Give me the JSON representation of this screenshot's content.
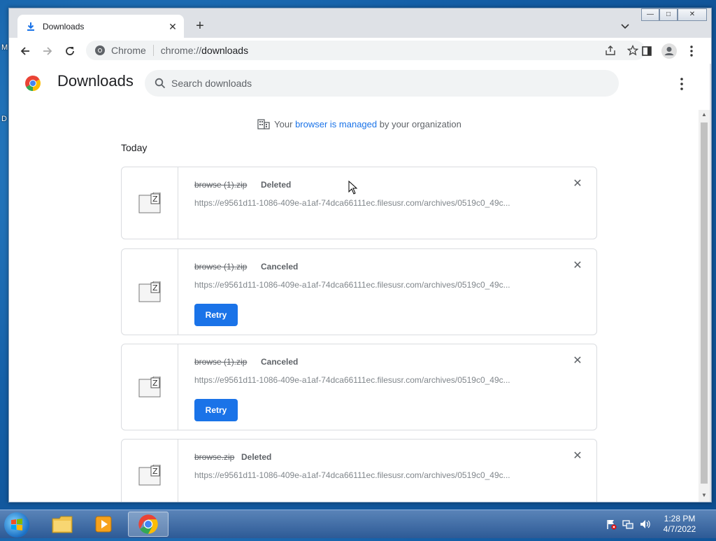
{
  "desktop": {
    "icon_labels": [
      "M",
      "D"
    ]
  },
  "window": {
    "controls": {
      "minimize": "—",
      "maximize": "□",
      "close": "✕"
    }
  },
  "tab": {
    "title": "Downloads",
    "icon": "download-icon",
    "close_label": "✕"
  },
  "new_tab_label": "+",
  "omnibox": {
    "site_label": "Chrome",
    "scheme": "chrome://",
    "host": "downloads"
  },
  "page": {
    "title": "Downloads",
    "search": {
      "placeholder": "Search downloads",
      "value": ""
    },
    "managed": {
      "prefix": "Your ",
      "link": "browser is managed",
      "suffix": " by your organization"
    },
    "section": "Today",
    "items": [
      {
        "file": "browse (1).zip",
        "status": "Deleted",
        "url": "https://e9561d11-1086-409e-a1af-74dca66111ec.filesusr.com/archives/0519c0_49c...",
        "retry": null
      },
      {
        "file": "browse (1).zip",
        "status": "Canceled",
        "url": "https://e9561d11-1086-409e-a1af-74dca66111ec.filesusr.com/archives/0519c0_49c...",
        "retry": "Retry"
      },
      {
        "file": "browse (1).zip",
        "status": "Canceled",
        "url": "https://e9561d11-1086-409e-a1af-74dca66111ec.filesusr.com/archives/0519c0_49c...",
        "retry": "Retry"
      },
      {
        "file": "browse.zip",
        "status": "Deleted",
        "url": "https://e9561d11-1086-409e-a1af-74dca66111ec.filesusr.com/archives/0519c0_49c...",
        "retry": null
      }
    ],
    "remove_label": "✕"
  },
  "taskbar": {
    "clock": {
      "time": "1:28 PM",
      "date": "4/7/2022"
    },
    "apps": [
      "windows-explorer",
      "media-player",
      "chrome"
    ]
  },
  "colors": {
    "accent": "#1a73e8",
    "link": "#1a73e8",
    "taskbar": "#2d5a96"
  }
}
